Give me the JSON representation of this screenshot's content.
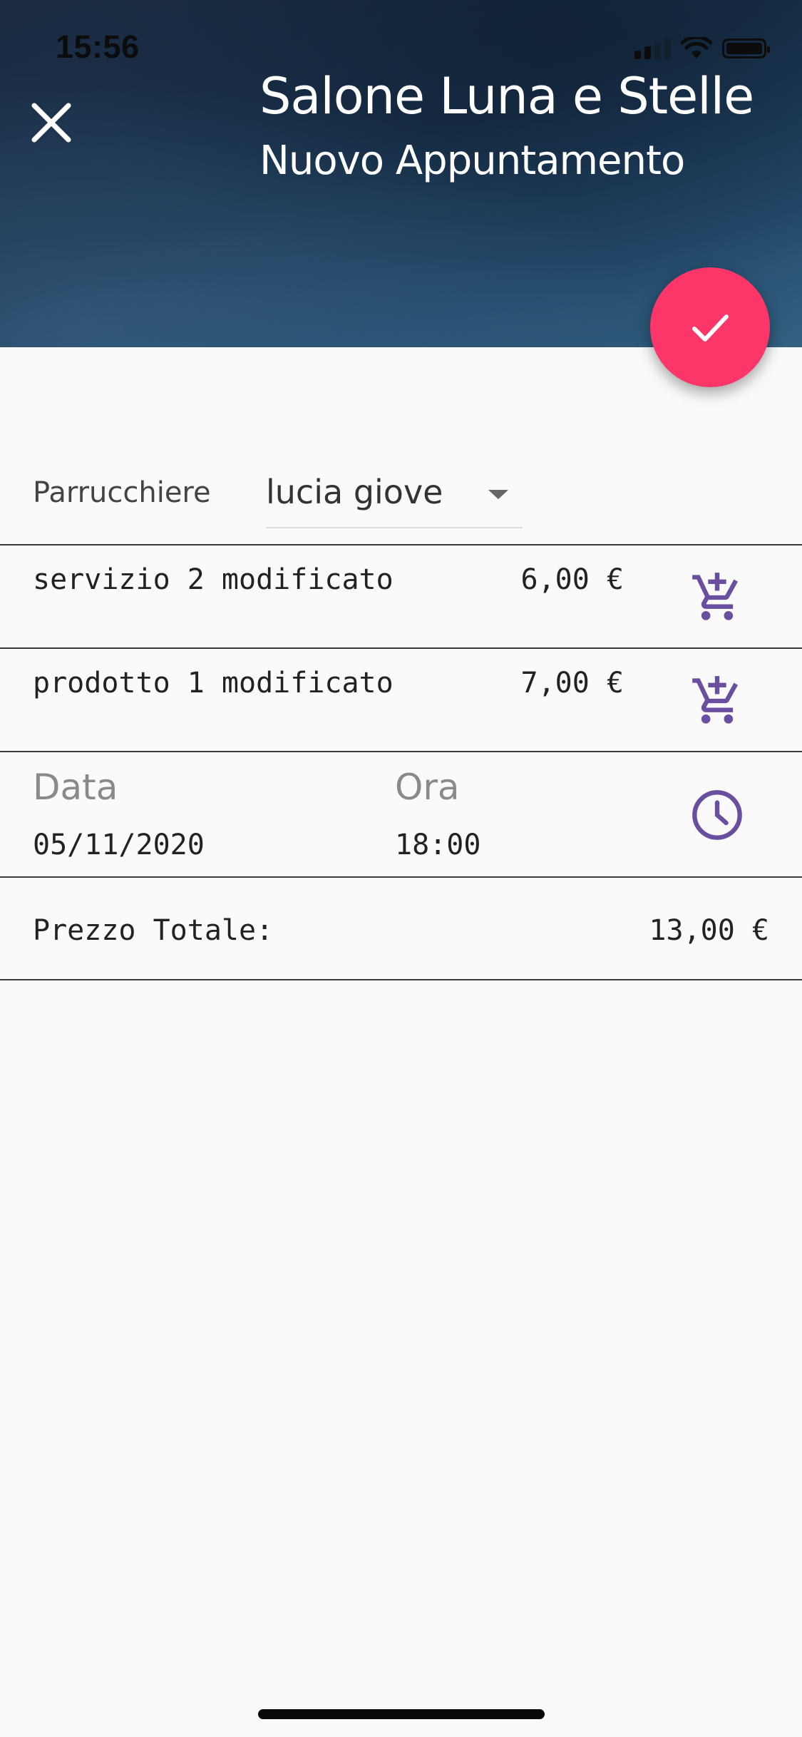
{
  "status_bar": {
    "time": "15:56"
  },
  "header": {
    "title": "Salone Luna e Stelle",
    "subtitle": "Nuovo Appuntamento"
  },
  "form": {
    "hairdresser_label": "Parrucchiere",
    "hairdresser_value": "lucia giove"
  },
  "items": [
    {
      "name": "servizio 2 modificato",
      "price": "6,00 €"
    },
    {
      "name": "prodotto 1 modificato",
      "price": "7,00 €"
    }
  ],
  "datetime": {
    "date_label": "Data",
    "date_value": "05/11/2020",
    "time_label": "Ora",
    "time_value": "18:00"
  },
  "total": {
    "label": "Prezzo Totale:",
    "value": "13,00 €"
  },
  "colors": {
    "accent": "#fc3669",
    "icon": "#6a4fa0",
    "header": "#1b2b41"
  },
  "icons": {
    "close": "close-icon",
    "confirm": "check-icon",
    "dropdown": "caret-down-icon",
    "cart": "add-shopping-cart-icon",
    "clock": "clock-icon"
  }
}
